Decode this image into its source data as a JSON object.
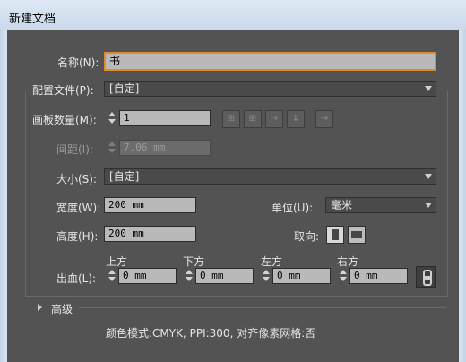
{
  "window": {
    "title": "新建文档"
  },
  "name": {
    "label": "名称(N):",
    "value": "书"
  },
  "profile": {
    "label": "配置文件(P):",
    "value": "[自定]"
  },
  "artboards": {
    "label": "画板数量(M):",
    "value": "1"
  },
  "spacing": {
    "label": "间距(I):",
    "value": "7.06 mm"
  },
  "size": {
    "label": "大小(S):",
    "value": "[自定]"
  },
  "width": {
    "label": "宽度(W):",
    "value": "200 mm"
  },
  "height": {
    "label": "高度(H):",
    "value": "200 mm"
  },
  "units": {
    "label": "单位(U):",
    "value": "毫米"
  },
  "orientation": {
    "label": "取向:"
  },
  "bleed": {
    "label": "出血(L):",
    "top": {
      "label": "上方",
      "value": "0 mm"
    },
    "bottom": {
      "label": "下方",
      "value": "0 mm"
    },
    "left": {
      "label": "左方",
      "value": "0 mm"
    },
    "right": {
      "label": "右方",
      "value": "0 mm"
    }
  },
  "advanced": {
    "label": "高级"
  },
  "summary": "颜色模式:CMYK, PPI:300, 对齐像素网格:否",
  "colors": {
    "accent": "#e08a2a",
    "panel": "#535353"
  },
  "icons": [
    "artboard-layout-grid-by-row-icon",
    "artboard-layout-grid-by-column-icon",
    "artboard-layout-row-icon",
    "artboard-layout-column-icon",
    "arrow-right-icon",
    "portrait-icon",
    "landscape-icon",
    "link-icon",
    "disclosure-triangle-icon"
  ]
}
